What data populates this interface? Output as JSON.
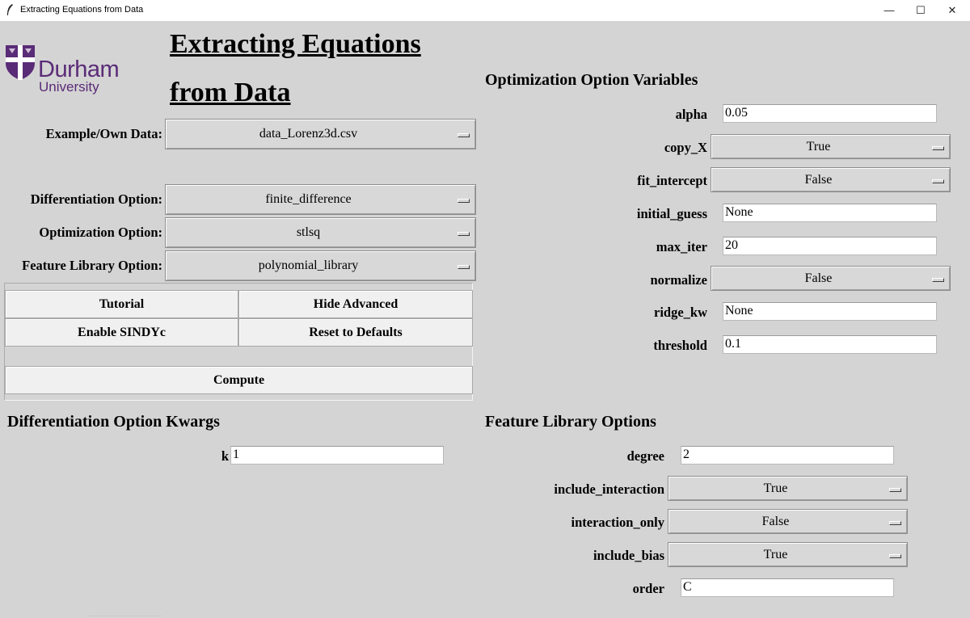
{
  "window": {
    "title": "Extracting Equations from Data",
    "minimize_glyph": "—",
    "maximize_glyph": "☐",
    "close_glyph": "✕"
  },
  "logo": {
    "word": "Durham",
    "sub": "University",
    "brand_color": "#5a2b77"
  },
  "heading": {
    "line1": "Extracting Equations",
    "line2": "from Data"
  },
  "left": {
    "example_label": "Example/Own Data:",
    "example_value": "data_Lorenz3d.csv",
    "diff_label": "Differentiation Option:",
    "diff_value": "finite_difference",
    "opt_label": "Optimization Option:",
    "opt_value": "stlsq",
    "feat_label": "Feature Library Option:",
    "feat_value": "polynomial_library"
  },
  "buttons": {
    "tutorial": "Tutorial",
    "hide_advanced": "Hide Advanced",
    "enable_sindyc": "Enable SINDYc",
    "reset": "Reset to Defaults",
    "compute": "Compute"
  },
  "opt_vars": {
    "title": "Optimization Option Variables",
    "alpha_label": "alpha",
    "alpha_value": "0.05",
    "copy_x_label": "copy_X",
    "copy_x_value": "True",
    "fit_intercept_label": "fit_intercept",
    "fit_intercept_value": "False",
    "initial_guess_label": "initial_guess",
    "initial_guess_value": "None",
    "max_iter_label": "max_iter",
    "max_iter_value": "20",
    "normalize_label": "normalize",
    "normalize_value": "False",
    "ridge_kw_label": "ridge_kw",
    "ridge_kw_value": "None",
    "threshold_label": "threshold",
    "threshold_value": "0.1"
  },
  "diff_kwargs": {
    "title": "Differentiation Option Kwargs",
    "k_label": "k",
    "k_value": "1"
  },
  "feat_opts": {
    "title": "Feature Library Options",
    "degree_label": "degree",
    "degree_value": "2",
    "include_interaction_label": "include_interaction",
    "include_interaction_value": "True",
    "interaction_only_label": "interaction_only",
    "interaction_only_value": "False",
    "include_bias_label": "include_bias",
    "include_bias_value": "True",
    "order_label": "order",
    "order_value": "C"
  }
}
